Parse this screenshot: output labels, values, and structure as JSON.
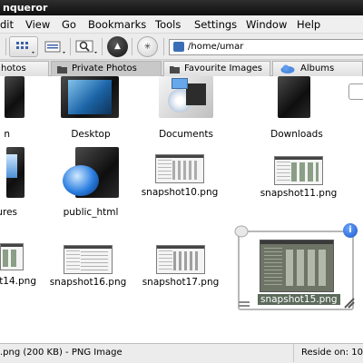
{
  "window": {
    "title": "nqueror"
  },
  "menubar": {
    "items": [
      {
        "label": "dit"
      },
      {
        "label": "View"
      },
      {
        "label": "Go"
      },
      {
        "label": "Bookmarks"
      },
      {
        "label": "Tools"
      },
      {
        "label": "Settings"
      },
      {
        "label": "Window"
      },
      {
        "label": "Help"
      }
    ]
  },
  "toolbar": {
    "location": "/home/umar",
    "icons": [
      "icon-view-icon",
      "detail-view-icon",
      "zoom-icon",
      "eject-icon",
      "settings-icon"
    ]
  },
  "tabs": [
    {
      "label": "hotos",
      "icon": "folder-icon"
    },
    {
      "label": "Private Photos",
      "icon": "folder-icon",
      "active": true
    },
    {
      "label": "Favourite Images",
      "icon": "folder-icon"
    },
    {
      "label": "Albums",
      "icon": "cloud-icon"
    }
  ],
  "files": [
    {
      "label": "n"
    },
    {
      "label": "Desktop"
    },
    {
      "label": "Documents"
    },
    {
      "label": "Downloads"
    },
    {
      "label": "ures"
    },
    {
      "label": "public_html"
    },
    {
      "label": "snapshot10.png"
    },
    {
      "label": "snapshot11.png"
    },
    {
      "label": "t14.png"
    },
    {
      "label": "snapshot16.png"
    },
    {
      "label": "snapshot17.png"
    },
    {
      "label": "snapshot15.png",
      "selected": true
    }
  ],
  "statusbar": {
    "left": ".png (200 KB) - PNG Image",
    "right": "Reside on: 10"
  },
  "colors": {
    "titlebar": "#1c1c1c",
    "selection": "#5c6b5c",
    "info": "#1d55c7"
  }
}
